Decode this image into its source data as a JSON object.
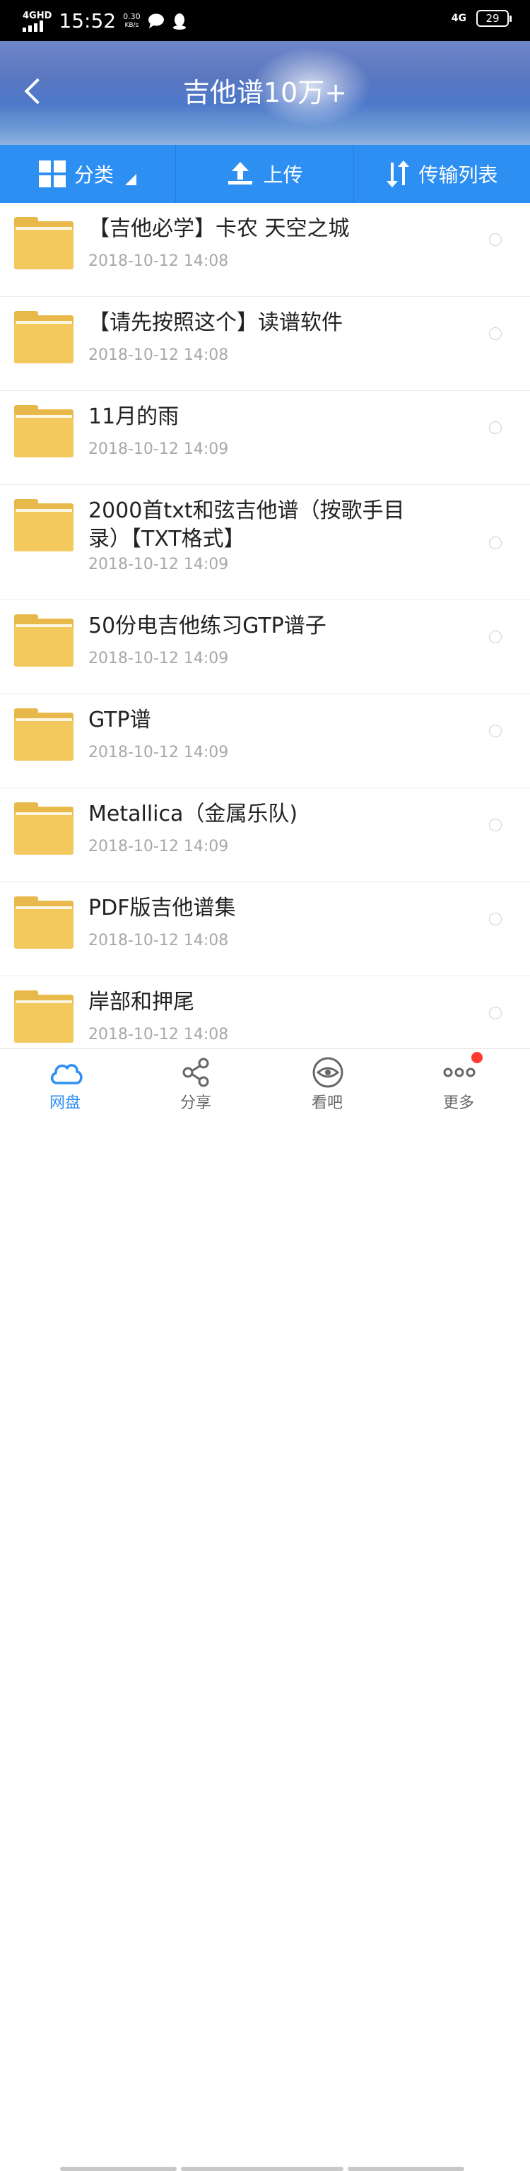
{
  "status_bar": {
    "network": "4GHD",
    "time": "15:52",
    "speed_value": "0.30",
    "speed_unit": "KB/s",
    "network_right": "4G",
    "battery": "29"
  },
  "header": {
    "title": "吉他谱10万+"
  },
  "toolbar": {
    "category_label": "分类",
    "upload_label": "上传",
    "transfer_label": "传输列表"
  },
  "files": [
    {
      "name": "【吉他必学】卡农 天空之城",
      "date": "2018-10-12  14:08"
    },
    {
      "name": "【请先按照这个】读谱软件",
      "date": "2018-10-12  14:08"
    },
    {
      "name": "11月的雨",
      "date": "2018-10-12  14:09"
    },
    {
      "name": "2000首txt和弦吉他谱（按歌手目录）【TXT格式】",
      "date": "2018-10-12  14:09"
    },
    {
      "name": "50份电吉他练习GTP谱子",
      "date": "2018-10-12  14:09"
    },
    {
      "name": "GTP谱",
      "date": "2018-10-12  14:09"
    },
    {
      "name": "Metallica（金属乐队)",
      "date": "2018-10-12  14:09"
    },
    {
      "name": "PDF版吉他谱集",
      "date": "2018-10-12  14:08"
    },
    {
      "name": "岸部和押尾",
      "date": "2018-10-12  14:08"
    }
  ],
  "bottom_nav": [
    {
      "label": "网盘",
      "icon": "cloud-icon",
      "active": true
    },
    {
      "label": "分享",
      "icon": "share-icon",
      "active": false
    },
    {
      "label": "看吧",
      "icon": "eye-icon",
      "active": false
    },
    {
      "label": "更多",
      "icon": "more-icon",
      "active": false
    }
  ],
  "colors": {
    "accent": "#2e8ff2",
    "folder": "#f3c85d",
    "badge": "#ff3b30"
  }
}
